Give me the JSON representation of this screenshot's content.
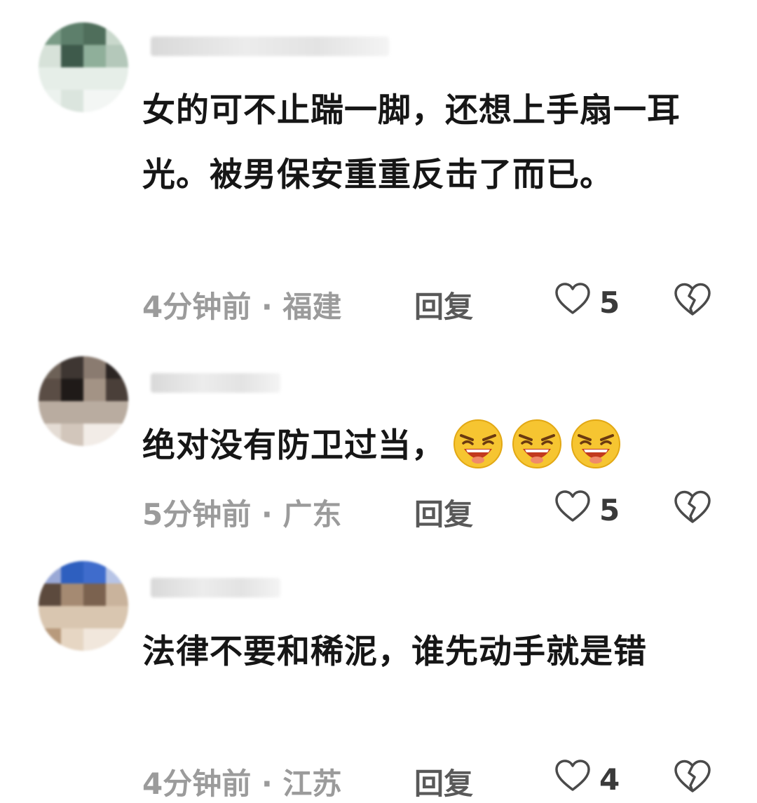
{
  "comments": [
    {
      "text": "女的可不止踹一脚，还想上手扇一耳光。被男保安重重反击了而已。",
      "time_location": "4分钟前 · 福建",
      "reply_label": "回复",
      "like_count": "5",
      "avatar_colors": [
        "#7a9b86",
        "#5d7f6b",
        "#4f6e5b",
        "#c9d8cc",
        "#d7e2d9",
        "#3e5a4b",
        "#8faf9a",
        "#b4c8ba",
        "#e6eee8",
        "#ecf2ee",
        "#dbe5de",
        "#f3f6f4"
      ]
    },
    {
      "text": "绝对没有防卫过当，",
      "emoji": [
        "laughing-emoji",
        "laughing-emoji",
        "laughing-emoji"
      ],
      "time_location": "5分钟前 · 广东",
      "reply_label": "回复",
      "like_count": "5",
      "avatar_colors": [
        "#6d6157",
        "#3e3632",
        "#8a7b70",
        "#2b2523",
        "#5a4d45",
        "#1f1a18",
        "#a39385",
        "#4a3f39",
        "#b9aca0",
        "#e4dcd4",
        "#d2c6bb",
        "#f2ece7"
      ]
    },
    {
      "text": "法律不要和稀泥，谁先动手就是错",
      "time_location": "4分钟前 · 江苏",
      "reply_label": "回复",
      "like_count": "4",
      "avatar_colors": [
        "#9aa9d6",
        "#2e5fbf",
        "#3f6ccc",
        "#b7c4e6",
        "#5c4a3d",
        "#a58a72",
        "#7b624f",
        "#c9b39c",
        "#d9c6b0",
        "#b89a7c",
        "#e6d6c3",
        "#f1e7dc"
      ]
    }
  ]
}
